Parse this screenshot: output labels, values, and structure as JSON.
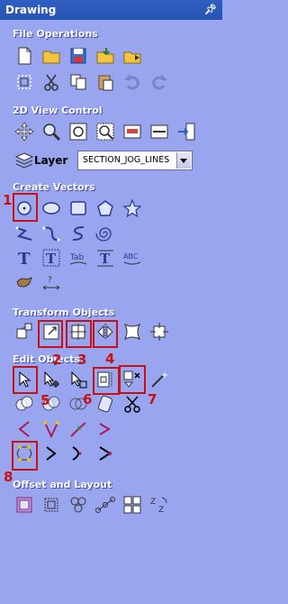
{
  "panel": {
    "title": "Drawing",
    "pin_icon": "pin-icon"
  },
  "sections": {
    "file_operations": "File Operations",
    "view_control": "2D View Control",
    "create_vectors": "Create Vectors",
    "transform_objects": "Transform Objects",
    "edit_objects": "Edit Objects",
    "offset_layout": "Offset and Layout"
  },
  "layer": {
    "label": "Layer",
    "value": "SECTION_JOG_LINES"
  },
  "annotations": {
    "n1": "1",
    "n2": "2",
    "n3": "3",
    "n4": "4",
    "n5": "5",
    "n6": "6",
    "n7": "7",
    "n8": "8"
  },
  "colors": {
    "panel_bg": "#9aa5ef",
    "title_bar": "#2553b3",
    "highlight": "#c81212"
  }
}
